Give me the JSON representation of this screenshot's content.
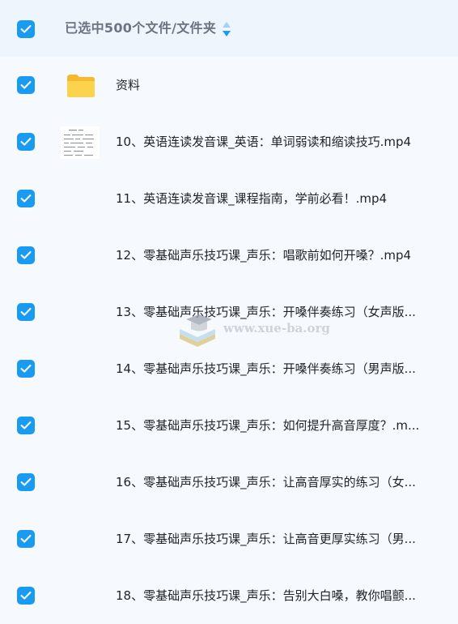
{
  "header": {
    "selection_text": "已选中500个文件/文件夹"
  },
  "colors": {
    "accent": "#1a9bf2",
    "folder": "#f9c23c",
    "background": "#f6faff"
  },
  "files": [
    {
      "name": "资料",
      "type": "folder",
      "icon": "folder-icon"
    },
    {
      "name": "10、英语连读发音课_英语：单词弱读和缩读技巧.mp4",
      "type": "video",
      "icon": "video-thumbnail"
    },
    {
      "name": "11、英语连读发音课_课程指南，学前必看！.mp4",
      "type": "video",
      "icon": "video-thumbnail"
    },
    {
      "name": "12、零基础声乐技巧课_声乐：唱歌前如何开嗓？.mp4",
      "type": "video",
      "icon": "video-thumbnail"
    },
    {
      "name": "13、零基础声乐技巧课_声乐：开嗓伴奏练习（女声版...",
      "type": "video",
      "icon": "video-thumbnail"
    },
    {
      "name": "14、零基础声乐技巧课_声乐：开嗓伴奏练习（男声版...",
      "type": "video",
      "icon": "video-thumbnail"
    },
    {
      "name": "15、零基础声乐技巧课_声乐：如何提升高音厚度？.m...",
      "type": "video",
      "icon": "video-thumbnail"
    },
    {
      "name": "16、零基础声乐技巧课_声乐：让高音厚实的练习（女...",
      "type": "video",
      "icon": "video-thumbnail"
    },
    {
      "name": "17、零基础声乐技巧课_声乐：让高音更厚实练习（男...",
      "type": "video",
      "icon": "video-thumbnail"
    },
    {
      "name": "18、零基础声乐技巧课_声乐：告别大白嗓，教你唱颤...",
      "type": "video",
      "icon": "video-thumbnail"
    }
  ],
  "watermark": {
    "text": "www.xue-ba.org"
  }
}
